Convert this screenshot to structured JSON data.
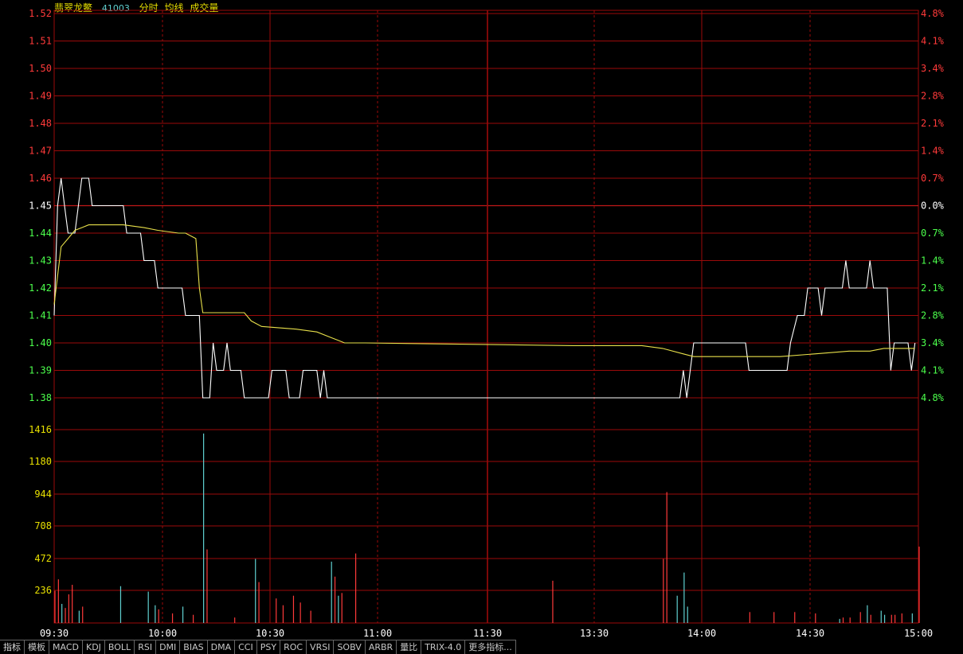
{
  "header": {
    "name": "翡翠龙鳖",
    "code": "41003",
    "labels": [
      "分时",
      "均线",
      "成交量"
    ]
  },
  "tabs": [
    "指标",
    "模板",
    "MACD",
    "KDJ",
    "BOLL",
    "RSI",
    "DMI",
    "BIAS",
    "DMA",
    "CCI",
    "PSY",
    "ROC",
    "VRSI",
    "SOBV",
    "ARBR",
    "量比",
    "TRIX-4.0",
    "更多指标..."
  ],
  "colors": {
    "grid": "#9b0a0a",
    "up": "#ff3a3a",
    "down": "#4cff4c",
    "price": "#ffffff",
    "avg": "#e8e04a",
    "vol_up": "#ff3a3a",
    "vol_down": "#5fd0d0",
    "axis_text": "#ffffff"
  },
  "chart_data": {
    "type": "line",
    "time_ticks": [
      "09:30",
      "10:00",
      "10:30",
      "11:00",
      "11:30",
      "13:30",
      "14:00",
      "14:30",
      "15:00"
    ],
    "price_ticks": [
      "1.52",
      "1.51",
      "1.50",
      "1.49",
      "1.48",
      "1.47",
      "1.46",
      "1.45",
      "1.44",
      "1.43",
      "1.42",
      "1.41",
      "1.40",
      "1.39",
      "1.38"
    ],
    "pct_ticks": [
      "4.8%",
      "4.1%",
      "3.4%",
      "2.8%",
      "2.1%",
      "1.4%",
      "0.7%",
      "0.0%",
      "0.7%",
      "1.4%",
      "2.1%",
      "2.8%",
      "3.4%",
      "4.1%",
      "4.8%"
    ],
    "volume_ticks": [
      "1416",
      "1180",
      "944",
      "708",
      "472",
      "236"
    ],
    "ylim": [
      1.38,
      1.52
    ],
    "prev_close": 1.45,
    "volume_max": 1652,
    "minutes": 241,
    "series": [
      {
        "name": "分时",
        "points": [
          [
            0,
            1.41
          ],
          [
            1,
            1.45
          ],
          [
            2,
            1.46
          ],
          [
            3,
            1.45
          ],
          [
            4,
            1.44
          ],
          [
            6,
            1.44
          ],
          [
            7,
            1.45
          ],
          [
            8,
            1.46
          ],
          [
            10,
            1.46
          ],
          [
            11,
            1.45
          ],
          [
            20,
            1.45
          ],
          [
            21,
            1.44
          ],
          [
            25,
            1.44
          ],
          [
            26,
            1.43
          ],
          [
            29,
            1.43
          ],
          [
            30,
            1.42
          ],
          [
            37,
            1.42
          ],
          [
            38,
            1.41
          ],
          [
            42,
            1.41
          ],
          [
            43,
            1.38
          ],
          [
            45,
            1.38
          ],
          [
            46,
            1.4
          ],
          [
            47,
            1.39
          ],
          [
            49,
            1.39
          ],
          [
            50,
            1.4
          ],
          [
            51,
            1.39
          ],
          [
            54,
            1.39
          ],
          [
            55,
            1.38
          ],
          [
            62,
            1.38
          ],
          [
            63,
            1.39
          ],
          [
            67,
            1.39
          ],
          [
            68,
            1.38
          ],
          [
            71,
            1.38
          ],
          [
            72,
            1.39
          ],
          [
            76,
            1.39
          ],
          [
            77,
            1.38
          ],
          [
            78,
            1.39
          ],
          [
            79,
            1.38
          ],
          [
            181,
            1.38
          ],
          [
            182,
            1.39
          ],
          [
            183,
            1.38
          ],
          [
            185,
            1.4
          ],
          [
            200,
            1.4
          ],
          [
            201,
            1.39
          ],
          [
            212,
            1.39
          ],
          [
            213,
            1.4
          ],
          [
            215,
            1.41
          ],
          [
            217,
            1.41
          ],
          [
            218,
            1.42
          ],
          [
            221,
            1.42
          ],
          [
            222,
            1.41
          ],
          [
            223,
            1.42
          ],
          [
            228,
            1.42
          ],
          [
            229,
            1.43
          ],
          [
            230,
            1.42
          ],
          [
            235,
            1.42
          ],
          [
            236,
            1.43
          ],
          [
            237,
            1.42
          ],
          [
            241,
            1.42
          ],
          [
            242,
            1.39
          ],
          [
            243,
            1.4
          ],
          [
            247,
            1.4
          ],
          [
            248,
            1.39
          ],
          [
            249,
            1.4
          ]
        ]
      },
      {
        "name": "均线",
        "points": [
          [
            0,
            1.414
          ],
          [
            2,
            1.435
          ],
          [
            4,
            1.438
          ],
          [
            6,
            1.441
          ],
          [
            8,
            1.442
          ],
          [
            10,
            1.443
          ],
          [
            20,
            1.443
          ],
          [
            26,
            1.442
          ],
          [
            30,
            1.441
          ],
          [
            36,
            1.44
          ],
          [
            38,
            1.44
          ],
          [
            41,
            1.438
          ],
          [
            42,
            1.42
          ],
          [
            43,
            1.411
          ],
          [
            55,
            1.411
          ],
          [
            57,
            1.408
          ],
          [
            60,
            1.406
          ],
          [
            70,
            1.405
          ],
          [
            76,
            1.404
          ],
          [
            80,
            1.402
          ],
          [
            82,
            1.401
          ],
          [
            84,
            1.4
          ],
          [
            90,
            1.4
          ],
          [
            150,
            1.399
          ],
          [
            170,
            1.399
          ],
          [
            176,
            1.398
          ],
          [
            182,
            1.396
          ],
          [
            185,
            1.395
          ],
          [
            200,
            1.395
          ],
          [
            210,
            1.395
          ],
          [
            220,
            1.396
          ],
          [
            230,
            1.397
          ],
          [
            236,
            1.397
          ],
          [
            240,
            1.398
          ],
          [
            249,
            1.398
          ]
        ]
      }
    ],
    "volume": [
      [
        0,
        236,
        "up"
      ],
      [
        1,
        320,
        "up"
      ],
      [
        2,
        140,
        "down"
      ],
      [
        3,
        110,
        "up"
      ],
      [
        4,
        210,
        "up"
      ],
      [
        5,
        280,
        "up"
      ],
      [
        7,
        90,
        "down"
      ],
      [
        8,
        120,
        "up"
      ],
      [
        19,
        270,
        "down"
      ],
      [
        27,
        230,
        "down"
      ],
      [
        29,
        130,
        "down"
      ],
      [
        30,
        100,
        "up"
      ],
      [
        34,
        70,
        "up"
      ],
      [
        37,
        120,
        "down"
      ],
      [
        40,
        60,
        "up"
      ],
      [
        43,
        1390,
        "down"
      ],
      [
        44,
        540,
        "up"
      ],
      [
        52,
        40,
        "up"
      ],
      [
        58,
        470,
        "down"
      ],
      [
        59,
        300,
        "up"
      ],
      [
        64,
        180,
        "up"
      ],
      [
        66,
        130,
        "up"
      ],
      [
        69,
        200,
        "up"
      ],
      [
        71,
        150,
        "up"
      ],
      [
        74,
        90,
        "up"
      ],
      [
        80,
        450,
        "down"
      ],
      [
        81,
        340,
        "up"
      ],
      [
        82,
        200,
        "down"
      ],
      [
        83,
        220,
        "up"
      ],
      [
        87,
        510,
        "up"
      ],
      [
        144,
        310,
        "up"
      ],
      [
        176,
        470,
        "up"
      ],
      [
        177,
        960,
        "up"
      ],
      [
        180,
        200,
        "down"
      ],
      [
        182,
        370,
        "down"
      ],
      [
        183,
        120,
        "down"
      ],
      [
        201,
        80,
        "up"
      ],
      [
        208,
        80,
        "up"
      ],
      [
        214,
        80,
        "up"
      ],
      [
        220,
        70,
        "up"
      ],
      [
        227,
        30,
        "down"
      ],
      [
        228,
        40,
        "up"
      ],
      [
        230,
        40,
        "up"
      ],
      [
        233,
        80,
        "up"
      ],
      [
        235,
        130,
        "down"
      ],
      [
        236,
        60,
        "up"
      ],
      [
        239,
        90,
        "down"
      ],
      [
        240,
        60,
        "down"
      ],
      [
        242,
        60,
        "up"
      ],
      [
        243,
        60,
        "up"
      ],
      [
        245,
        70,
        "up"
      ],
      [
        248,
        70,
        "down"
      ],
      [
        250,
        560,
        "up"
      ]
    ]
  }
}
